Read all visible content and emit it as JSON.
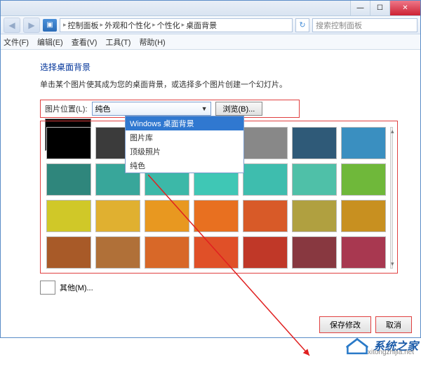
{
  "titlebar": {
    "min": "—",
    "max": "☐",
    "close": "✕"
  },
  "nav": {
    "back": "◀",
    "fwd": "▶",
    "breadcrumb": [
      "控制面板",
      "外观和个性化",
      "个性化",
      "桌面背景"
    ],
    "search_placeholder": "搜索控制面板",
    "refresh": "↻"
  },
  "menu": {
    "file": "文件(F)",
    "edit": "编辑(E)",
    "view": "查看(V)",
    "tools": "工具(T)",
    "help": "帮助(H)"
  },
  "page": {
    "heading": "选择桌面背景",
    "subtext": "单击某个图片使其成为您的桌面背景，或选择多个图片创建一个幻灯片。",
    "location_label": "图片位置(L):",
    "combo_value": "纯色",
    "browse": "浏览(B)...",
    "dropdown": {
      "opt0": "Windows 桌面背景",
      "opt1": "图片库",
      "opt2": "顶级照片",
      "opt3": "纯色"
    },
    "other": "其他(M)...",
    "save": "保存修改",
    "cancel": "取消"
  },
  "colors": [
    "#000000",
    "#3b3b3b",
    "#3f6f6f",
    "#2e8b84",
    "#888888",
    "#2f5a78",
    "#3a8fc0",
    "#2f867c",
    "#38a69a",
    "#3cb8a8",
    "#3fc7b5",
    "#3ebdae",
    "#4fc0a8",
    "#6fb83a",
    "#d0c828",
    "#e0b030",
    "#e89820",
    "#e87020",
    "#d85a28",
    "#b0a040",
    "#c89020",
    "#a85a28",
    "#b07038",
    "#d86828",
    "#e05028",
    "#c03828",
    "#883840",
    "#a83850"
  ],
  "watermark": {
    "text": "系统之家",
    "url": "xitongzhijia.net"
  }
}
